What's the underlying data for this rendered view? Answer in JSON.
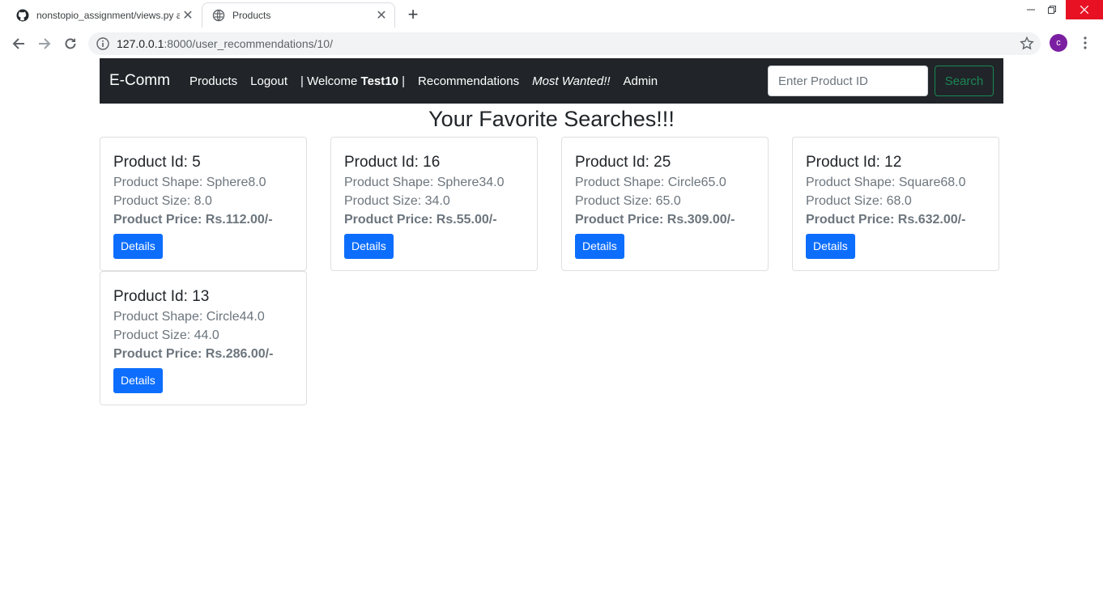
{
  "browser": {
    "tabs": [
      {
        "title": "nonstopio_assignment/views.py a",
        "favicon": "github-icon",
        "active": false
      },
      {
        "title": "Products",
        "favicon": "globe-icon",
        "active": true
      }
    ],
    "url_host": "127.0.0.1",
    "url_path": ":8000/user_recommendations/10/",
    "profile_initial": "c"
  },
  "navbar": {
    "brand": "E-Comm",
    "links": {
      "products": "Products",
      "logout": "Logout",
      "welcome_prefix": "| Welcome ",
      "welcome_user": "Test10",
      "welcome_suffix": " |",
      "recommendations": "Recommendations",
      "most_wanted": "Most Wanted!!",
      "admin": "Admin"
    },
    "search": {
      "placeholder": "Enter Product ID",
      "button": "Search"
    }
  },
  "page": {
    "title": "Your Favorite Searches!!!"
  },
  "products": [
    {
      "title": "Product Id: 5",
      "shape": "Product Shape: Sphere8.0",
      "size": "Product Size: 8.0",
      "price": "Product Price: Rs.112.00/-",
      "button": "Details"
    },
    {
      "title": "Product Id: 16",
      "shape": "Product Shape: Sphere34.0",
      "size": "Product Size: 34.0",
      "price": "Product Price: Rs.55.00/-",
      "button": "Details"
    },
    {
      "title": "Product Id: 25",
      "shape": "Product Shape: Circle65.0",
      "size": "Product Size: 65.0",
      "price": "Product Price: Rs.309.00/-",
      "button": "Details"
    },
    {
      "title": "Product Id: 12",
      "shape": "Product Shape: Square68.0",
      "size": "Product Size: 68.0",
      "price": "Product Price: Rs.632.00/-",
      "button": "Details"
    },
    {
      "title": "Product Id: 13",
      "shape": "Product Shape: Circle44.0",
      "size": "Product Size: 44.0",
      "price": "Product Price: Rs.286.00/-",
      "button": "Details"
    }
  ],
  "colors": {
    "navbar_bg": "#212529",
    "primary": "#0d6efd",
    "success": "#198754",
    "profile": "#7b1fa2"
  }
}
